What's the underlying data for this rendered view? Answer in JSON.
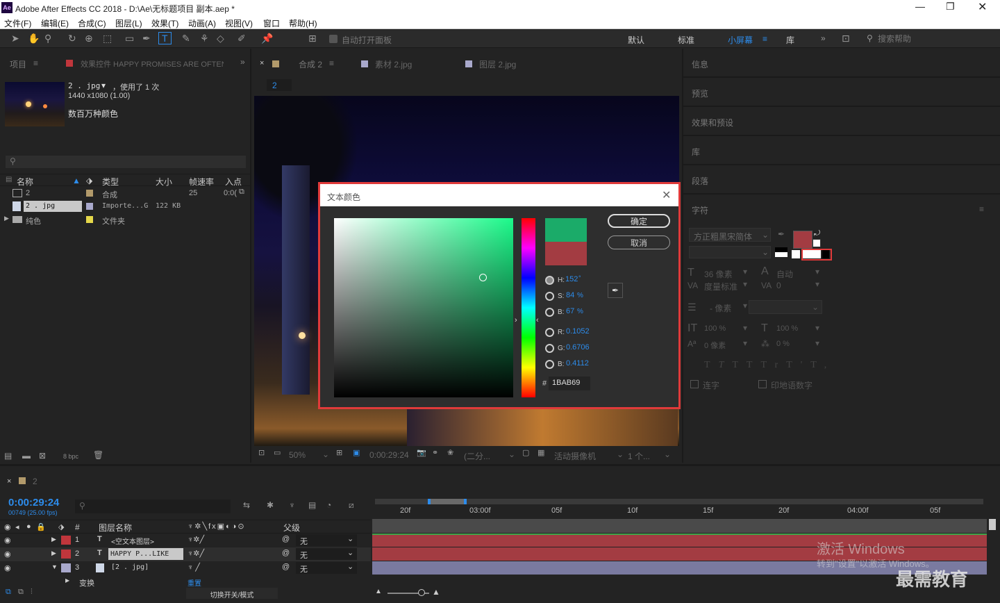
{
  "app": {
    "title": "Adobe After Effects CC 2018 - D:\\Ae\\无标题项目 副本.aep *",
    "logo": "Ae"
  },
  "menu": [
    "文件(F)",
    "编辑(E)",
    "合成(C)",
    "图层(L)",
    "效果(T)",
    "动画(A)",
    "视图(V)",
    "窗口",
    "帮助(H)"
  ],
  "toolbar": {
    "auto_open": "自动打开面板",
    "workspaces": [
      "默认",
      "标准",
      "小屏幕",
      "库"
    ],
    "active_workspace": "小屏幕",
    "search_placeholder": "搜索帮助"
  },
  "project": {
    "tabs": [
      "项目",
      "效果控件 HAPPY PROMISES ARE OFTEN"
    ],
    "item_name": "2 . jpg",
    "item_usage": "，使用了 1 次",
    "item_size": "1440 x1080 (1.00)",
    "item_colors": "数百万种颜色",
    "columns": [
      "名称",
      "类型",
      "大小",
      "帧速率",
      "入点"
    ],
    "rows": [
      {
        "name": "2",
        "type": "合成",
        "size": "",
        "fps": "25",
        "in": "0:0(",
        "color": "#b29a6b"
      },
      {
        "name": "2 . jpg",
        "type": "Importe...G",
        "size": "122 KB",
        "fps": "",
        "in": "",
        "color": "#a9a9cc"
      },
      {
        "name": "纯色",
        "type": "文件夹",
        "size": "",
        "fps": "",
        "in": "",
        "color": "#e5d84a"
      }
    ],
    "bpc": "8 bpc"
  },
  "comp": {
    "tabs": [
      "合成 2",
      "素材 2.jpg",
      "图层 2.jpg"
    ],
    "breadcrumb": "2",
    "footer": {
      "zoom": "50%",
      "time": "0:00:29:24",
      "res": "(二分...",
      "camera": "活动摄像机",
      "views": "1 个..."
    }
  },
  "right": {
    "panels": [
      "信息",
      "预览",
      "效果和预设",
      "库",
      "段落",
      "字符"
    ],
    "font": "方正粗黑宋简体",
    "font_size": "36 像素",
    "leading": "自动",
    "kerning": "度量标准",
    "tracking": "0",
    "stroke": "- 像素",
    "vscale": "100 %",
    "hscale": "100 %",
    "baseline": "0 像素",
    "tsume": "0 %",
    "ligatures": "连字",
    "hindi": "印地语数字",
    "fill_color": "#a33c42"
  },
  "dialog": {
    "title": "文本颜色",
    "ok": "确定",
    "cancel": "取消",
    "hsb": [
      {
        "label": "H:",
        "value": "152",
        "unit": "°"
      },
      {
        "label": "S:",
        "value": "84",
        "unit": "%"
      },
      {
        "label": "B:",
        "value": "67",
        "unit": "%"
      }
    ],
    "rgb": [
      {
        "label": "R:",
        "value": "0.1052"
      },
      {
        "label": "G:",
        "value": "0.6706"
      },
      {
        "label": "B:",
        "value": "0.4112"
      }
    ],
    "hex_label": "#",
    "hex": "1BAB69",
    "new_color": "#1bab69",
    "old_color": "#a33c42"
  },
  "timeline": {
    "tab": "2",
    "timecode": "0:00:29:24",
    "frames": "00749 (25.00 fps)",
    "ruler": [
      "20f",
      "03:00f",
      "05f",
      "10f",
      "15f",
      "20f",
      "04:00f",
      "05f"
    ],
    "headers": [
      "#",
      "图层名称",
      "父级"
    ],
    "layers": [
      {
        "num": "1",
        "type": "T",
        "name": "<空文本图层>",
        "parent": "无",
        "color": "#c0363c"
      },
      {
        "num": "2",
        "type": "T",
        "name": "HAPPY P...LIKE",
        "parent": "无",
        "color": "#c0363c"
      },
      {
        "num": "3",
        "type": "",
        "name": "[2 . jpg]",
        "parent": "无",
        "color": "#a9a9cc"
      }
    ],
    "transform": "变换",
    "reset": "重置",
    "switch_label": "切换开关/模式"
  },
  "watermark": {
    "line1": "激活 Windows",
    "line2": "转到\"设置\"以激活 Windows。",
    "brand": "最需教育"
  }
}
